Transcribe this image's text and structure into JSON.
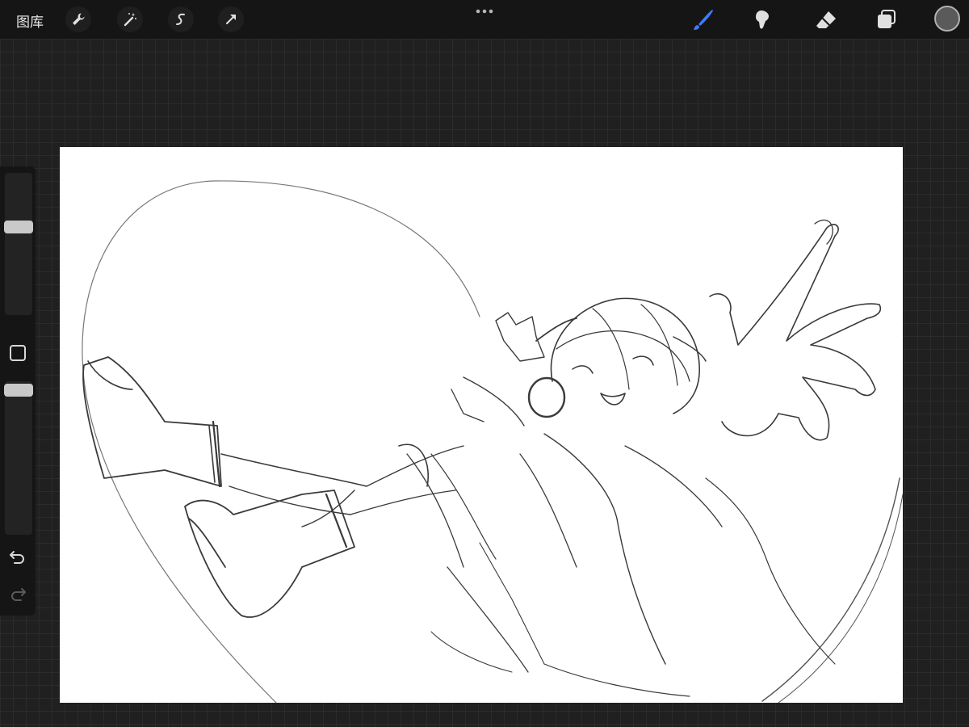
{
  "toolbar": {
    "gallery_label": "图库",
    "left_tools": [
      "wrench-icon",
      "magic-wand-icon",
      "selection-icon",
      "transform-icon"
    ],
    "right_tools": [
      "brush-icon",
      "smudge-icon",
      "eraser-icon",
      "layers-icon"
    ],
    "active_tool": "brush",
    "active_color": "#3b7bff",
    "current_color": "#5a5a5a"
  },
  "sidebar": {
    "brush_size": 0.63,
    "brush_opacity": 0.98,
    "controls": [
      "brush-size-slider",
      "modify-button",
      "opacity-slider",
      "undo-icon",
      "redo-icon"
    ]
  },
  "canvas": {
    "background": "#ffffff",
    "content": "pencil sketch"
  }
}
